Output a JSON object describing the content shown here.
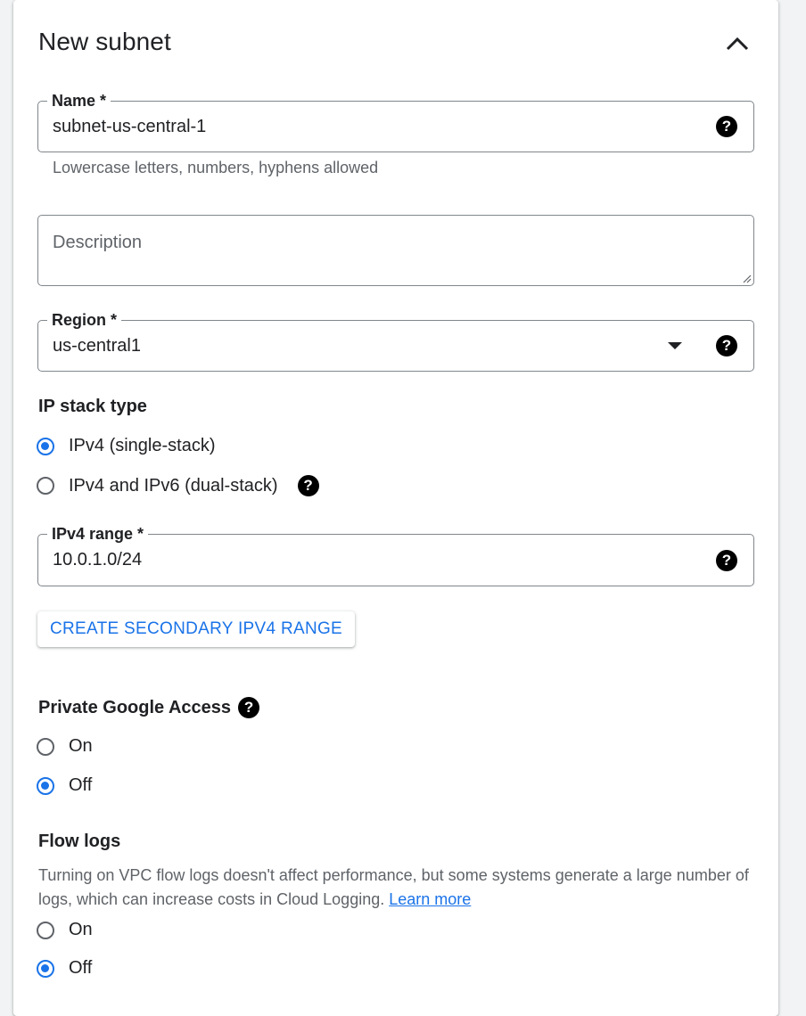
{
  "panel": {
    "title": "New subnet"
  },
  "name_field": {
    "label": "Name *",
    "value": "subnet-us-central-1",
    "hint": "Lowercase letters, numbers, hyphens allowed"
  },
  "description_field": {
    "placeholder": "Description"
  },
  "region_field": {
    "label": "Region *",
    "value": "us-central1"
  },
  "ip_stack": {
    "title": "IP stack type",
    "options": [
      {
        "label": "IPv4 (single-stack)",
        "selected": true
      },
      {
        "label": "IPv4 and IPv6 (dual-stack)",
        "selected": false
      }
    ]
  },
  "ipv4_range_field": {
    "label": "IPv4 range *",
    "value": "10.0.1.0/24"
  },
  "secondary_range_button": {
    "label": "CREATE SECONDARY IPV4 RANGE"
  },
  "private_google_access": {
    "title": "Private Google Access",
    "options": [
      {
        "label": "On",
        "selected": false
      },
      {
        "label": "Off",
        "selected": true
      }
    ]
  },
  "flow_logs": {
    "title": "Flow logs",
    "description": "Turning on VPC flow logs doesn't affect performance, but some systems generate a large number of logs, which can increase costs in Cloud Logging.",
    "learn_more": "Learn more",
    "options": [
      {
        "label": "On",
        "selected": false
      },
      {
        "label": "Off",
        "selected": true
      }
    ]
  },
  "help_glyph": "?",
  "colors": {
    "accent": "#1a73e8",
    "border": "#80868b",
    "text": "#202124",
    "secondary_text": "#5f6368"
  }
}
